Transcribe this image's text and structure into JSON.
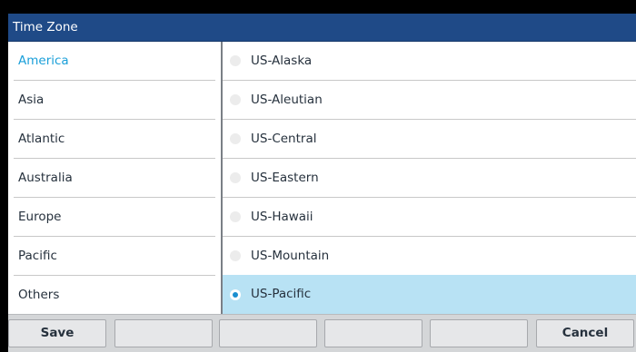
{
  "window": {
    "title": "Time Zone"
  },
  "regions": [
    {
      "label": "America",
      "selected": true
    },
    {
      "label": "Asia",
      "selected": false
    },
    {
      "label": "Atlantic",
      "selected": false
    },
    {
      "label": "Australia",
      "selected": false
    },
    {
      "label": "Europe",
      "selected": false
    },
    {
      "label": "Pacific",
      "selected": false
    },
    {
      "label": "Others",
      "selected": false
    }
  ],
  "zones": [
    {
      "label": "US-Alaska",
      "selected": false
    },
    {
      "label": "US-Aleutian",
      "selected": false
    },
    {
      "label": "US-Central",
      "selected": false
    },
    {
      "label": "US-Eastern",
      "selected": false
    },
    {
      "label": "US-Hawaii",
      "selected": false
    },
    {
      "label": "US-Mountain",
      "selected": false
    },
    {
      "label": "US-Pacific",
      "selected": true
    }
  ],
  "softkeys": [
    {
      "label": "Save"
    },
    {
      "label": ""
    },
    {
      "label": ""
    },
    {
      "label": ""
    },
    {
      "label": ""
    },
    {
      "label": "Cancel"
    }
  ],
  "colors": {
    "titlebar": "#1f4a87",
    "accent": "#1a9fd9",
    "selected_row": "#b8e2f4",
    "softkey_bar": "#d4d6d8"
  }
}
